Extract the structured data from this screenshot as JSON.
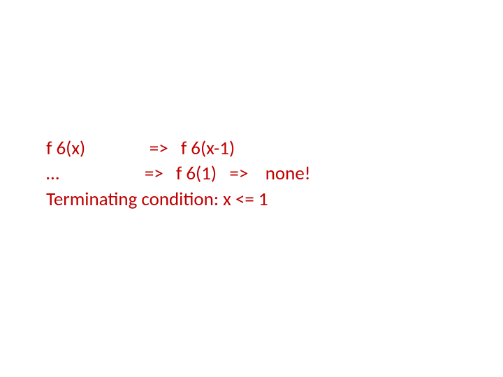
{
  "slide": {
    "lines": [
      " f 6(x)               =>   f 6(x-1)",
      " …                    =>   f 6(1)   =>    none!",
      " Terminating condition: x <= 1"
    ]
  }
}
